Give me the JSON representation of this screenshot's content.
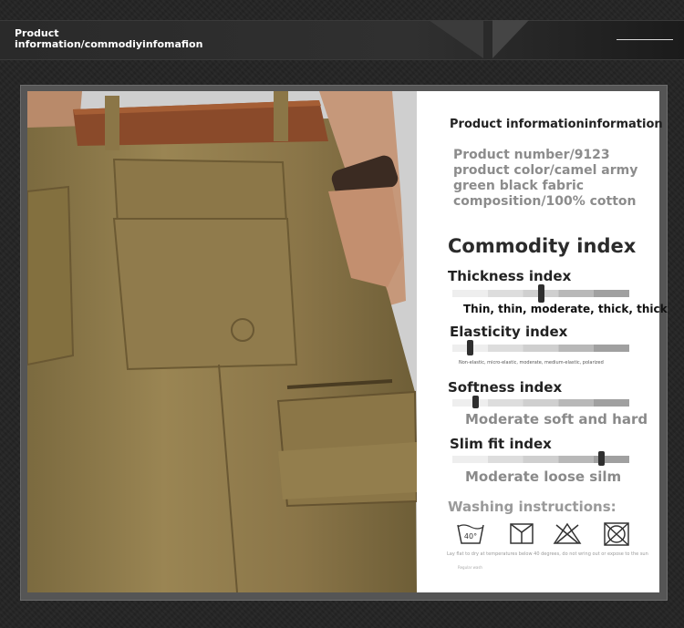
{
  "header": {
    "title_line1": "Product",
    "title_line2": "information/commodiyinfomafion"
  },
  "product_info": {
    "heading": "Product informationinformation",
    "number": "Product number/9123",
    "color_line1": "product color/camel army",
    "color_line2": "green black fabric",
    "composition": "composition/100% cotton"
  },
  "commodity_index": {
    "heading": "Commodity index",
    "thickness": {
      "title": "Thickness index",
      "scale": "Thin, thin, moderate, thick, thick",
      "level": 0.5
    },
    "elasticity": {
      "title": "Elasticity index",
      "scale": "Non-elastic, micro-elastic, moderate, medium-elastic, polarized",
      "level": 0.1
    },
    "softness": {
      "title": "Softness index",
      "scale": "Moderate soft and hard",
      "level": 0.13
    },
    "slim_fit": {
      "title": "Slim fit index",
      "scale": "Moderate loose silm",
      "level": 0.84
    }
  },
  "washing": {
    "title": "Washing instructions:",
    "temp_label": "40°",
    "icons": [
      "wash-40-icon",
      "hang-dry-icon",
      "no-bleach-icon",
      "no-tumble-dry-icon"
    ],
    "note": "Lay flat to dry at temperatures below 40 degrees, do not wring out or expose to the sun",
    "sub": "Regular wash"
  },
  "colors": {
    "background": "#242424",
    "pants": "#8f7a4a",
    "belt": "#8a4a2a"
  }
}
